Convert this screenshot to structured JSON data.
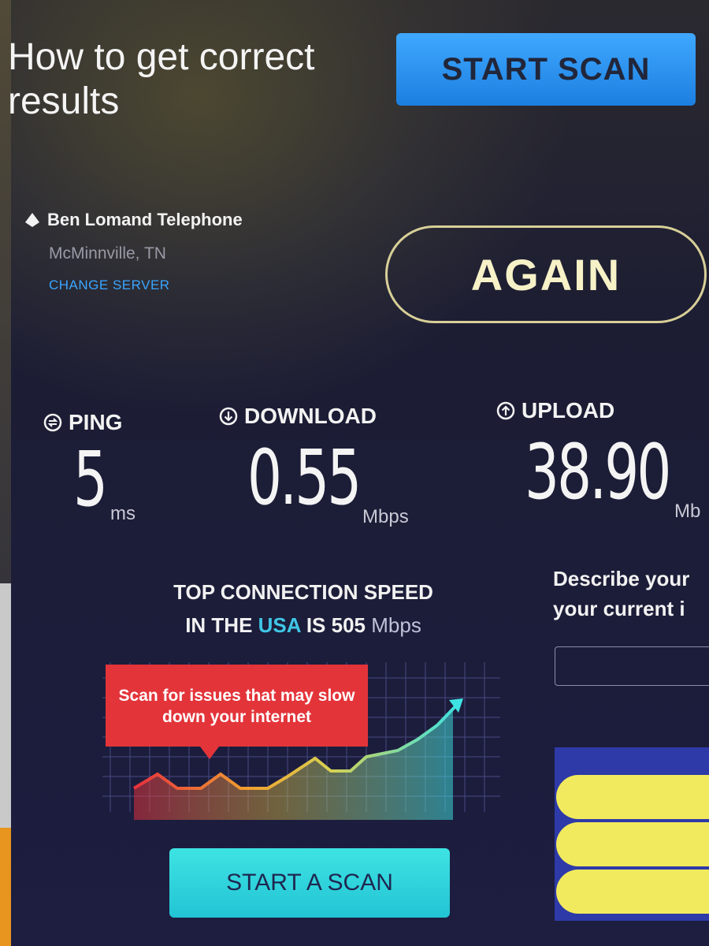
{
  "header": {
    "title": "How to get correct results",
    "start_scan_label": "START SCAN"
  },
  "server": {
    "provider": "Ben Lomand Telephone",
    "location": "McMinnville, TN",
    "change_label": "CHANGE SERVER"
  },
  "again_label": "AGAIN",
  "metrics": {
    "ping": {
      "label": "PING",
      "value": "5",
      "unit": "ms"
    },
    "download": {
      "label": "DOWNLOAD",
      "value": "0.55",
      "unit": "Mbps"
    },
    "upload": {
      "label": "UPLOAD",
      "value": "38.90",
      "unit": "Mb"
    }
  },
  "promo": {
    "line1": "TOP CONNECTION SPEED",
    "line2_prefix": "IN THE",
    "country": "USA",
    "line2_mid": "IS 505",
    "unit": "Mbps",
    "callout": "Scan for issues that may slow down your internet",
    "button_label": "START A SCAN"
  },
  "feedback": {
    "line1": "Describe your",
    "line2": "your current i"
  },
  "colors": {
    "start_scan_bg": "#2a94f4",
    "again_border": "#d8cf98",
    "accent_usa": "#3fc6e6",
    "callout_bg": "#e3343a",
    "start_a_scan_bg": "#30d6de",
    "yellow_option": "#f2ea5e"
  },
  "icons": {
    "server": "location-pin-icon",
    "ping": "ping-icon",
    "download": "download-arrow-icon",
    "upload": "upload-arrow-icon"
  }
}
